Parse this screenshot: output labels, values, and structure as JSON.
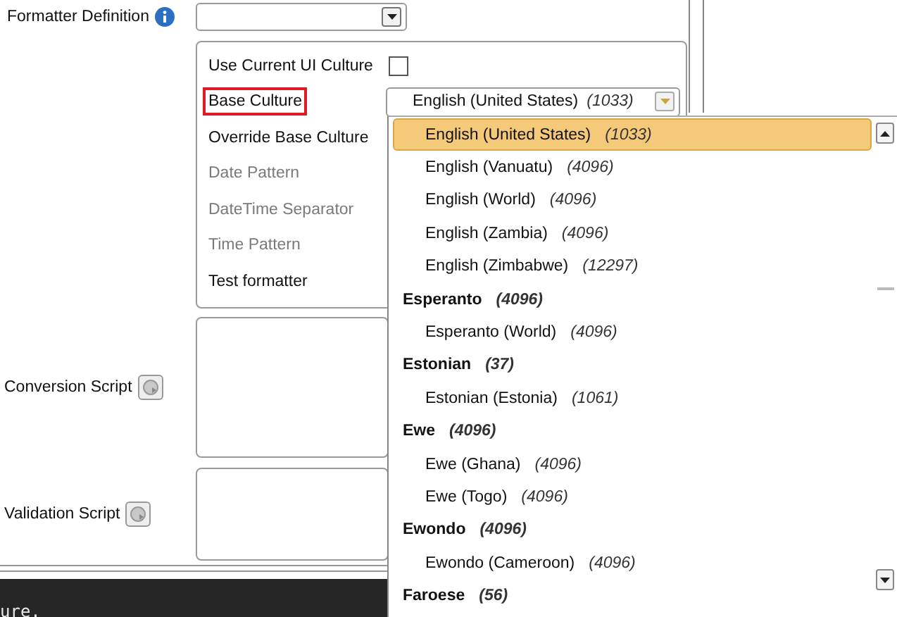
{
  "formatter_definition": {
    "label": "Formatter Definition"
  },
  "culture_group": {
    "rows": [
      {
        "label": "Use Current UI Culture",
        "kind": "checkbox",
        "checked": false,
        "disabled": false,
        "highlighted": false
      },
      {
        "label": "Base Culture",
        "kind": "combo",
        "disabled": false,
        "highlighted": true,
        "value": "English (United States)",
        "code": "(1033)"
      },
      {
        "label": "Override Base Culture",
        "kind": "plain",
        "disabled": false,
        "highlighted": false
      },
      {
        "label": "Date Pattern",
        "kind": "plain",
        "disabled": true,
        "highlighted": false
      },
      {
        "label": "DateTime Separator",
        "kind": "plain",
        "disabled": true,
        "highlighted": false
      },
      {
        "label": "Time Pattern",
        "kind": "plain",
        "disabled": true,
        "highlighted": false
      },
      {
        "label": "Test formatter",
        "kind": "plain",
        "disabled": false,
        "highlighted": false
      }
    ]
  },
  "scripts": [
    {
      "label": "Conversion Script"
    },
    {
      "label": "Validation Script"
    }
  ],
  "console": {
    "text": "ure."
  },
  "culture_dropdown": {
    "items": [
      {
        "name": "English (United States)",
        "code": "(1033)",
        "kind": "culture",
        "selected": true
      },
      {
        "name": "English (Vanuatu)",
        "code": "(4096)",
        "kind": "culture",
        "selected": false
      },
      {
        "name": "English (World)",
        "code": "(4096)",
        "kind": "culture",
        "selected": false
      },
      {
        "name": "English (Zambia)",
        "code": "(4096)",
        "kind": "culture",
        "selected": false
      },
      {
        "name": "English (Zimbabwe)",
        "code": "(12297)",
        "kind": "culture",
        "selected": false
      },
      {
        "name": "Esperanto",
        "code": "(4096)",
        "kind": "language",
        "selected": false
      },
      {
        "name": "Esperanto (World)",
        "code": "(4096)",
        "kind": "culture",
        "selected": false
      },
      {
        "name": "Estonian",
        "code": "(37)",
        "kind": "language",
        "selected": false
      },
      {
        "name": "Estonian (Estonia)",
        "code": "(1061)",
        "kind": "culture",
        "selected": false
      },
      {
        "name": "Ewe",
        "code": "(4096)",
        "kind": "language",
        "selected": false
      },
      {
        "name": "Ewe (Ghana)",
        "code": "(4096)",
        "kind": "culture",
        "selected": false
      },
      {
        "name": "Ewe (Togo)",
        "code": "(4096)",
        "kind": "culture",
        "selected": false
      },
      {
        "name": "Ewondo",
        "code": "(4096)",
        "kind": "language",
        "selected": false
      },
      {
        "name": "Ewondo (Cameroon)",
        "code": "(4096)",
        "kind": "culture",
        "selected": false
      },
      {
        "name": "Faroese",
        "code": "(56)",
        "kind": "language",
        "selected": false
      }
    ]
  }
}
